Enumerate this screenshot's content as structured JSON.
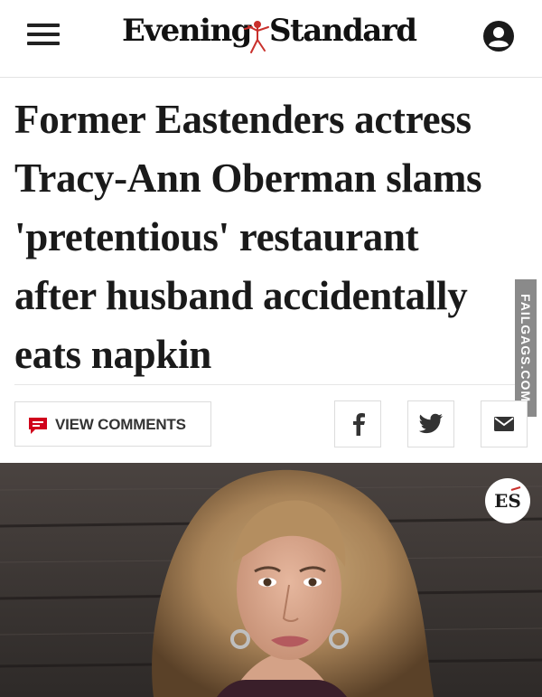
{
  "header": {
    "logo_word_1": "Evening",
    "logo_word_2": "Standard",
    "menu_icon": "hamburger-menu-icon",
    "account_icon": "user-account-icon"
  },
  "article": {
    "headline_lines": [
      "Former Eastenders actress",
      "Tracy-Ann Oberman slams",
      "'pretentious' restaurant",
      "after husband accidentally",
      "eats napkin"
    ]
  },
  "actions": {
    "view_comments_label": "VIEW COMMENTS",
    "comments_icon": "comment-icon",
    "share_icons": [
      "facebook-icon",
      "twitter-icon",
      "email-icon"
    ]
  },
  "watermark": {
    "text": "FAILGAGS.COM"
  },
  "photo": {
    "badge_text": "ES"
  },
  "colors": {
    "accent_red": "#d0021b",
    "text_dark": "#1a1a1a",
    "border": "#dcdcdc",
    "watermark_bg": "#8a8a8a"
  }
}
